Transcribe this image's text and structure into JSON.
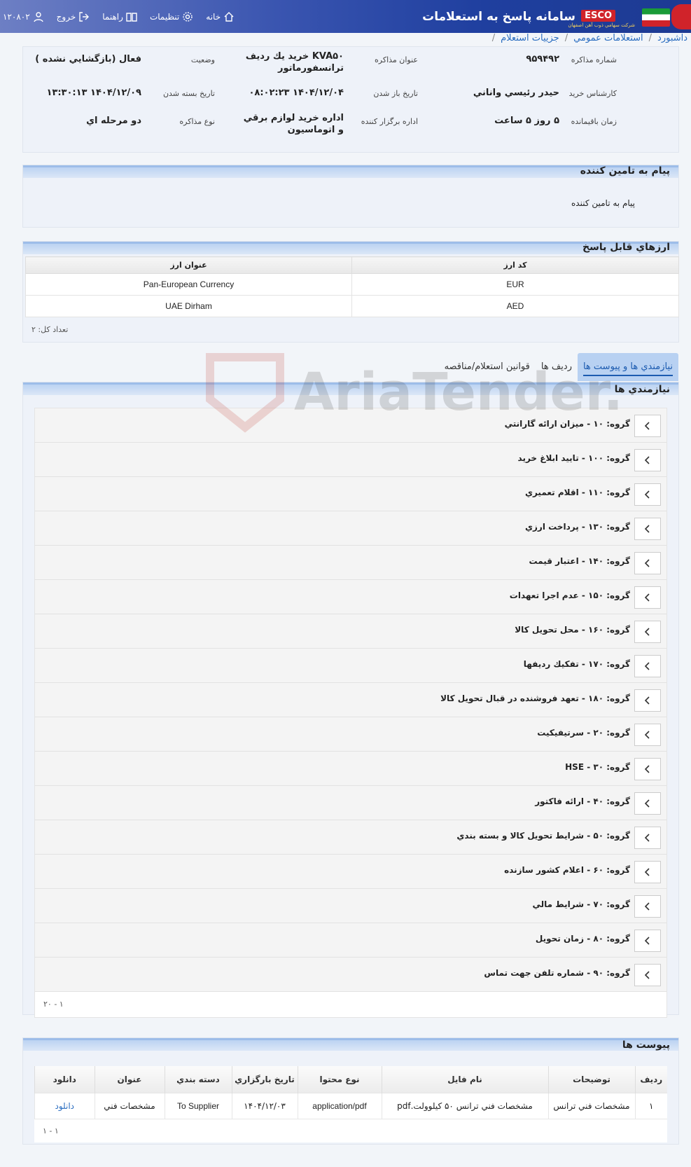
{
  "header": {
    "app_title": "سامانه پاسخ به استعلامات",
    "brand": "ESCO",
    "brand_sub": "شركت سهامي ذوب آهن اصفهان",
    "nav": {
      "home": "خانه",
      "settings": "تنظيمات",
      "help": "راهنما",
      "logout": "خروج",
      "user": "۱۲۰۸۰۲"
    }
  },
  "breadcrumb": [
    "ه داشبورد",
    "استعلامات عمومي",
    "جزييات استعلام"
  ],
  "info": {
    "negotiation_no_label": "شماره مذاكره",
    "negotiation_no": "۹۵۹۴۹۲",
    "title_label": "عنوان مذاكره",
    "title": "KVA۵۰ خريد يك رديف ترانسفورماتور",
    "status_label": "وضعيت",
    "status": "فعال (بازگشايي نشده )",
    "expert_label": "كارشناس خريد",
    "expert": "حيدر رئيسي واناني",
    "open_date_label": "تاريخ باز شدن",
    "open_date": "۱۴۰۴/۱۲/۰۴ ۰۸:۰۲:۲۳",
    "close_date_label": "تاريخ بسته شدن",
    "close_date": "۱۴۰۴/۱۲/۰۹ ۱۳:۳۰:۱۳",
    "remaining_label": "زمان باقيمانده",
    "remaining": "۵ روز ۵ ساعت",
    "dept_label": "اداره برگزار كننده",
    "dept": "اداره خريد لوازم برقي و اتوماسيون",
    "type_label": "نوع مذاكره",
    "type": "دو مرحله اي"
  },
  "supplier_message": {
    "title": "پيام به تامين كننده",
    "text": "پيام به تامين كننده"
  },
  "currencies": {
    "title": "ارزهاي قابل پاسخ",
    "headers": {
      "code": "كد ارز",
      "name": "عنوان ارز"
    },
    "rows": [
      {
        "code": "EUR",
        "name": "Pan-European Currency"
      },
      {
        "code": "AED",
        "name": "UAE Dirham"
      }
    ],
    "total": "تعداد كل: ۲"
  },
  "tabs": [
    "نيازمندي ها و پيوست ها",
    "رديف ها",
    "قوانين استعلام/مناقصه"
  ],
  "requirements": {
    "title": "نيازمندي ها",
    "groups": [
      "گروه: ۱۰ - ميزان ارائه گارانتي",
      "گروه: ۱۰۰ - تاييد ابلاغ خريد",
      "گروه: ۱۱۰ - اقلام تعميري",
      "گروه: ۱۳۰ - پرداخت ارزي",
      "گروه: ۱۴۰ - اعتبار قيمت",
      "گروه: ۱۵۰ - عدم اجرا تعهدات",
      "گروه: ۱۶۰ - محل تحويل كالا",
      "گروه: ۱۷۰ - تفكيك رديفها",
      "گروه: ۱۸۰ - تعهد فروشنده در قبال تحويل كالا",
      "گروه: ۲۰ - سرتيفيكيت",
      "گروه: ۳۰ - HSE",
      "گروه: ۴۰ - ارائه فاكتور",
      "گروه: ۵۰ - شرايط تحويل كالا و بسته بندي",
      "گروه: ۶۰ - اعلام كشور سازنده",
      "گروه: ۷۰ - شرايط مالي",
      "گروه: ۸۰ - زمان تحويل",
      "گروه: ۹۰ - شماره تلفن جهت تماس"
    ],
    "pager": "۱ - ۲۰"
  },
  "attachments": {
    "title": "پيوست ها",
    "headers": [
      "رديف",
      "توضيحات",
      "نام فايل",
      "نوع محتوا",
      "تاريخ بارگزاري",
      "دسته بندي",
      "عنوان",
      "دانلود"
    ],
    "rows": [
      [
        "۱",
        "مشخصات فني ترانس",
        "مشخصات فني ترانس ۵۰ كيلوولت.pdf",
        "application/pdf",
        "۱۴۰۴/۱۲/۰۳",
        "To Supplier",
        "مشخصات فني",
        "دانلود"
      ]
    ],
    "pager": "۱ - ۱"
  },
  "watermark": "AriaTender.neT",
  "colors": {
    "accent": "#1c5bb0",
    "header_dark": "#1d3a92",
    "section_header": "#bcd3f2"
  }
}
